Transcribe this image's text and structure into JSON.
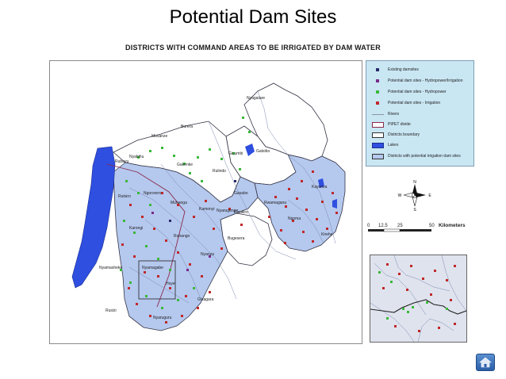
{
  "slide": {
    "title": "Potential Dam Sites",
    "map_title": "DISTRICTS WITH COMMAND AREAS TO BE IRRIGATED BY DAM WATER"
  },
  "legend": {
    "items": [
      {
        "label": "Existing damsites",
        "symbol": "square",
        "color": "#2a2a6a"
      },
      {
        "label": "Potential dam sites - Hydropower/Irrigation",
        "symbol": "square",
        "color": "#7a2a8a"
      },
      {
        "label": "Potential dam sites - Hydropower",
        "symbol": "square",
        "color": "#3bb83b"
      },
      {
        "label": "Potential dam sites - Irrigation",
        "symbol": "square",
        "color": "#c0282a"
      },
      {
        "label": "Rivers",
        "symbol": "line",
        "color": "#8a96a4"
      },
      {
        "label": "PIPET divide",
        "symbol": "box",
        "color": "#ffffff"
      },
      {
        "label": "Districts boundary",
        "symbol": "box",
        "color": "#ffffff"
      },
      {
        "label": "Lakes",
        "symbol": "box",
        "color": "#2f4fe0"
      },
      {
        "label": "Districts with potential irrigation dam sites",
        "symbol": "box",
        "color": "#b5c8ee"
      }
    ]
  },
  "compass": {
    "n": "N",
    "s": "S",
    "e": "E",
    "w": "W"
  },
  "scale": {
    "ticks": [
      "0",
      "12.5",
      "25",
      "50"
    ],
    "unit": "Kilometers"
  },
  "districts": [
    "Nyagatare",
    "Gatsibo",
    "Kayonza",
    "Rwamagana",
    "Ngoma",
    "Kirehe",
    "Bugesera",
    "Gasabo",
    "Kicukiro",
    "Nyarugenge",
    "Rulindo",
    "Gakenke",
    "Musanze",
    "Burera",
    "Gicumbi",
    "Nyabihu",
    "Rubavu",
    "Rutsiro",
    "Ngororero",
    "Muhanga",
    "Kamonyi",
    "Karongi",
    "Ruhango",
    "Nyanza",
    "Nyamagabe",
    "Huye",
    "Gisagara",
    "Nyamasheke",
    "Rusizi",
    "Nyaruguru"
  ],
  "colors": {
    "irrigation_district": "#b5c8ee",
    "lake": "#2f4fe0",
    "river": "#7b8ab0",
    "boundary": "#333344"
  },
  "nav": {
    "home_icon": "home-icon"
  }
}
